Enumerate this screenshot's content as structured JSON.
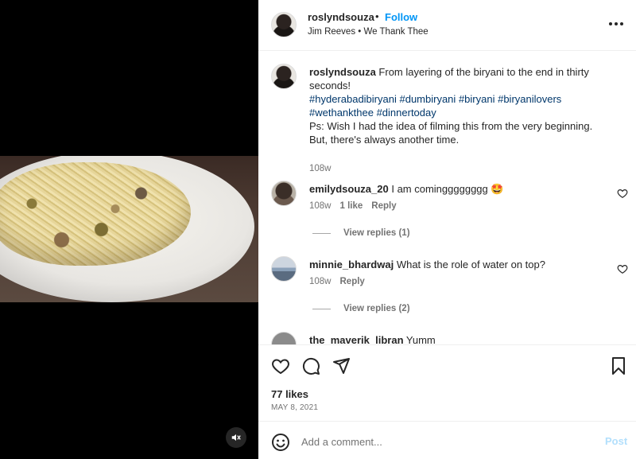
{
  "post": {
    "author": "roslyndsouza",
    "separator": "•",
    "follow_label": "Follow",
    "audio": "Jim Reeves • We Thank Thee"
  },
  "caption": {
    "author": "roslyndsouza",
    "line1": "From layering of the biryani to the end in thirty seconds!",
    "hashtags": [
      "#hyderabadibiryani",
      "#dumbiryani",
      "#biryani",
      "#biryanilovers",
      "#wethankthee",
      "#dinnertoday"
    ],
    "ps_line1": "Ps: Wish I had the idea of filming this from the very beginning.",
    "ps_line2": "But, there's always another time.",
    "time": "108w"
  },
  "comments": [
    {
      "user": "emilydsouza_20",
      "text": "I am comingggggggg",
      "emoji": "🤩",
      "time": "108w",
      "likes": "1 like",
      "reply_label": "Reply",
      "view_replies": "View replies (1)"
    },
    {
      "user": "minnie_bhardwaj",
      "text": "What is the role of water on top?",
      "time": "108w",
      "reply_label": "Reply",
      "view_replies": "View replies (2)"
    },
    {
      "user": "the_maverik_libran",
      "text": "Yumm"
    }
  ],
  "engagement": {
    "likes": "77 likes",
    "date": "MAY 8, 2021"
  },
  "composer": {
    "placeholder": "Add a comment...",
    "post_label": "Post"
  },
  "icons": {
    "like": "heart-icon",
    "comment": "comment-icon",
    "share": "share-icon",
    "save": "bookmark-icon",
    "more": "more-icon",
    "mute": "audio-muted-icon",
    "emoji": "emoji-icon"
  },
  "colors": {
    "link": "#0095f6",
    "hashtag": "#00376b",
    "muted_text": "#737373",
    "post_disabled": "#b2dffc"
  }
}
